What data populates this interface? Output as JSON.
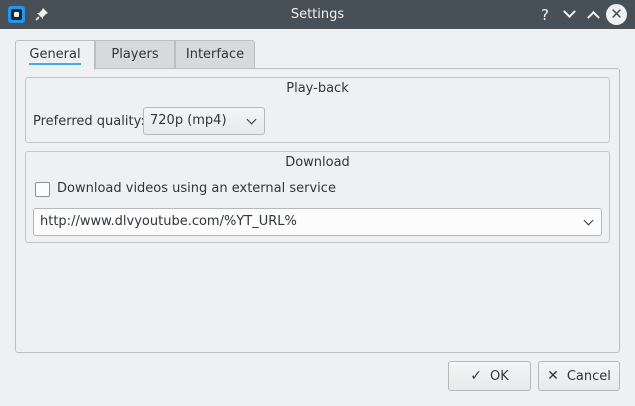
{
  "window": {
    "title": "Settings"
  },
  "titlebar": {
    "help_glyph": "?",
    "close_glyph": "✕"
  },
  "tabs": [
    {
      "label": "General",
      "active": true
    },
    {
      "label": "Players",
      "active": false
    },
    {
      "label": "Interface",
      "active": false
    }
  ],
  "playback": {
    "title": "Play-back",
    "quality_label": "Preferred quality:",
    "quality_value": "720p (mp4)"
  },
  "download": {
    "title": "Download",
    "external_checkbox_label": "Download videos using an external service",
    "external_checked": false,
    "service_url": "http://www.dlvyoutube.com/%YT_URL%"
  },
  "buttons": {
    "ok_label": "OK",
    "cancel_label": "Cancel",
    "ok_icon": "✓",
    "cancel_icon": "✕"
  },
  "icons": {
    "app": "app-icon",
    "pin": "pin-icon",
    "help": "help-icon",
    "minimize": "chevron-down-icon",
    "maximize": "chevron-up-icon",
    "close": "close-icon"
  }
}
